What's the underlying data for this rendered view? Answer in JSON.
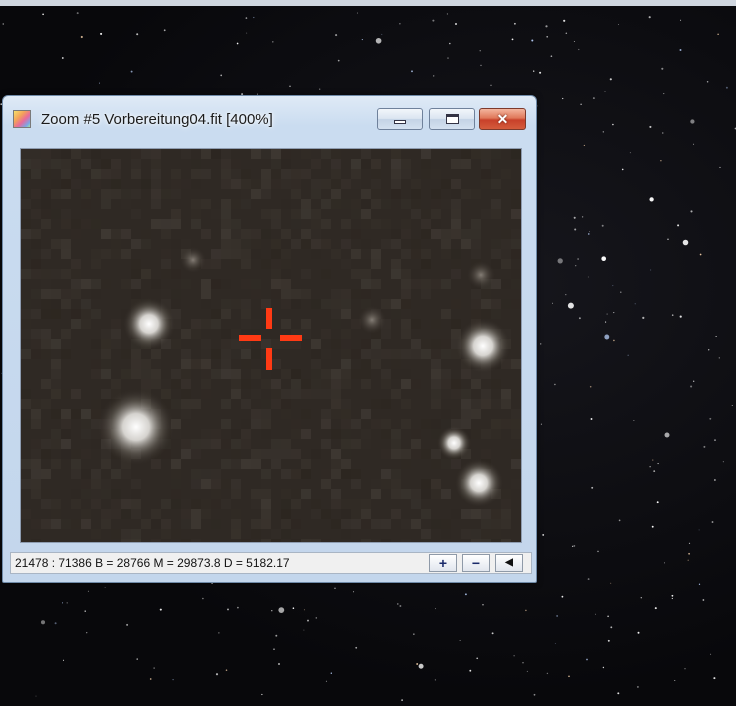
{
  "zoom_window": {
    "title": "Zoom #5 Vorbereitung04.fit  [400%]",
    "zoom_level": "400%",
    "buttons": {
      "minimize_icon": "minimize-icon",
      "maximize_icon": "maximize-icon",
      "close_label": "✕"
    },
    "status": {
      "text": "21478 : 71386  B = 28766  M = 29873.8  D = 5182.17",
      "zoom_in_label": "+",
      "zoom_out_label": "−",
      "scroll_left_label": "◀"
    }
  },
  "colors": {
    "crosshair": "#ff3a14",
    "canvas_background": "#2c2622",
    "titlebar": "#cadcf0",
    "close_button": "#c8412a"
  },
  "icons": [
    "app-icon",
    "minimize-icon",
    "maximize-icon",
    "close-icon",
    "crosshair-icon"
  ]
}
